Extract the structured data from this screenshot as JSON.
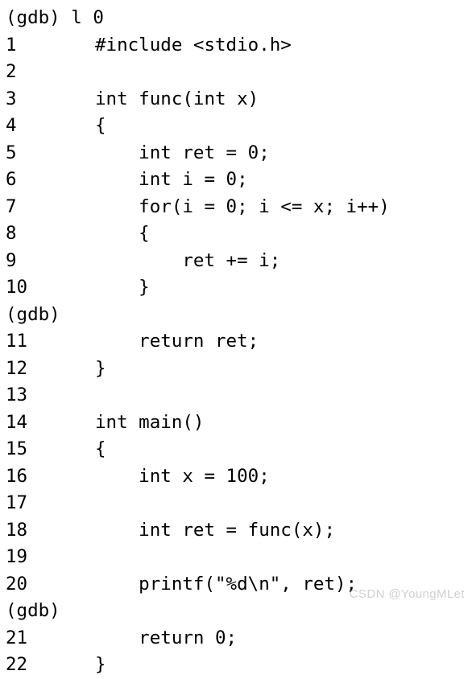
{
  "terminal": {
    "prompt": "(gdb)",
    "command": "l 0",
    "command_line": "(gdb) l 0",
    "background_color": "#ffffff",
    "text_color": "#000000",
    "lines": [
      {
        "kind": "prompt",
        "text": "(gdb) l 0"
      },
      {
        "kind": "source",
        "number": "1",
        "code": "#include <stdio.h>"
      },
      {
        "kind": "source",
        "number": "2",
        "code": ""
      },
      {
        "kind": "source",
        "number": "3",
        "code": "int func(int x)"
      },
      {
        "kind": "source",
        "number": "4",
        "code": "{"
      },
      {
        "kind": "source",
        "number": "5",
        "code": "    int ret = 0;"
      },
      {
        "kind": "source",
        "number": "6",
        "code": "    int i = 0;"
      },
      {
        "kind": "source",
        "number": "7",
        "code": "    for(i = 0; i <= x; i++)"
      },
      {
        "kind": "source",
        "number": "8",
        "code": "    {"
      },
      {
        "kind": "source",
        "number": "9",
        "code": "        ret += i;"
      },
      {
        "kind": "source",
        "number": "10",
        "code": "    }"
      },
      {
        "kind": "prompt",
        "text": "(gdb)"
      },
      {
        "kind": "source",
        "number": "11",
        "code": "    return ret;"
      },
      {
        "kind": "source",
        "number": "12",
        "code": "}"
      },
      {
        "kind": "source",
        "number": "13",
        "code": ""
      },
      {
        "kind": "source",
        "number": "14",
        "code": "int main()"
      },
      {
        "kind": "source",
        "number": "15",
        "code": "{"
      },
      {
        "kind": "source",
        "number": "16",
        "code": "    int x = 100;"
      },
      {
        "kind": "source",
        "number": "17",
        "code": ""
      },
      {
        "kind": "source",
        "number": "18",
        "code": "    int ret = func(x);"
      },
      {
        "kind": "source",
        "number": "19",
        "code": ""
      },
      {
        "kind": "source",
        "number": "20",
        "code": "    printf(\"%d\\n\", ret);"
      },
      {
        "kind": "prompt",
        "text": "(gdb)"
      },
      {
        "kind": "source",
        "number": "21",
        "code": "    return 0;"
      },
      {
        "kind": "source",
        "number": "22",
        "code": "}"
      }
    ]
  },
  "watermark": {
    "text": "CSDN @YoungMLet",
    "color": "#d0d0d0"
  }
}
